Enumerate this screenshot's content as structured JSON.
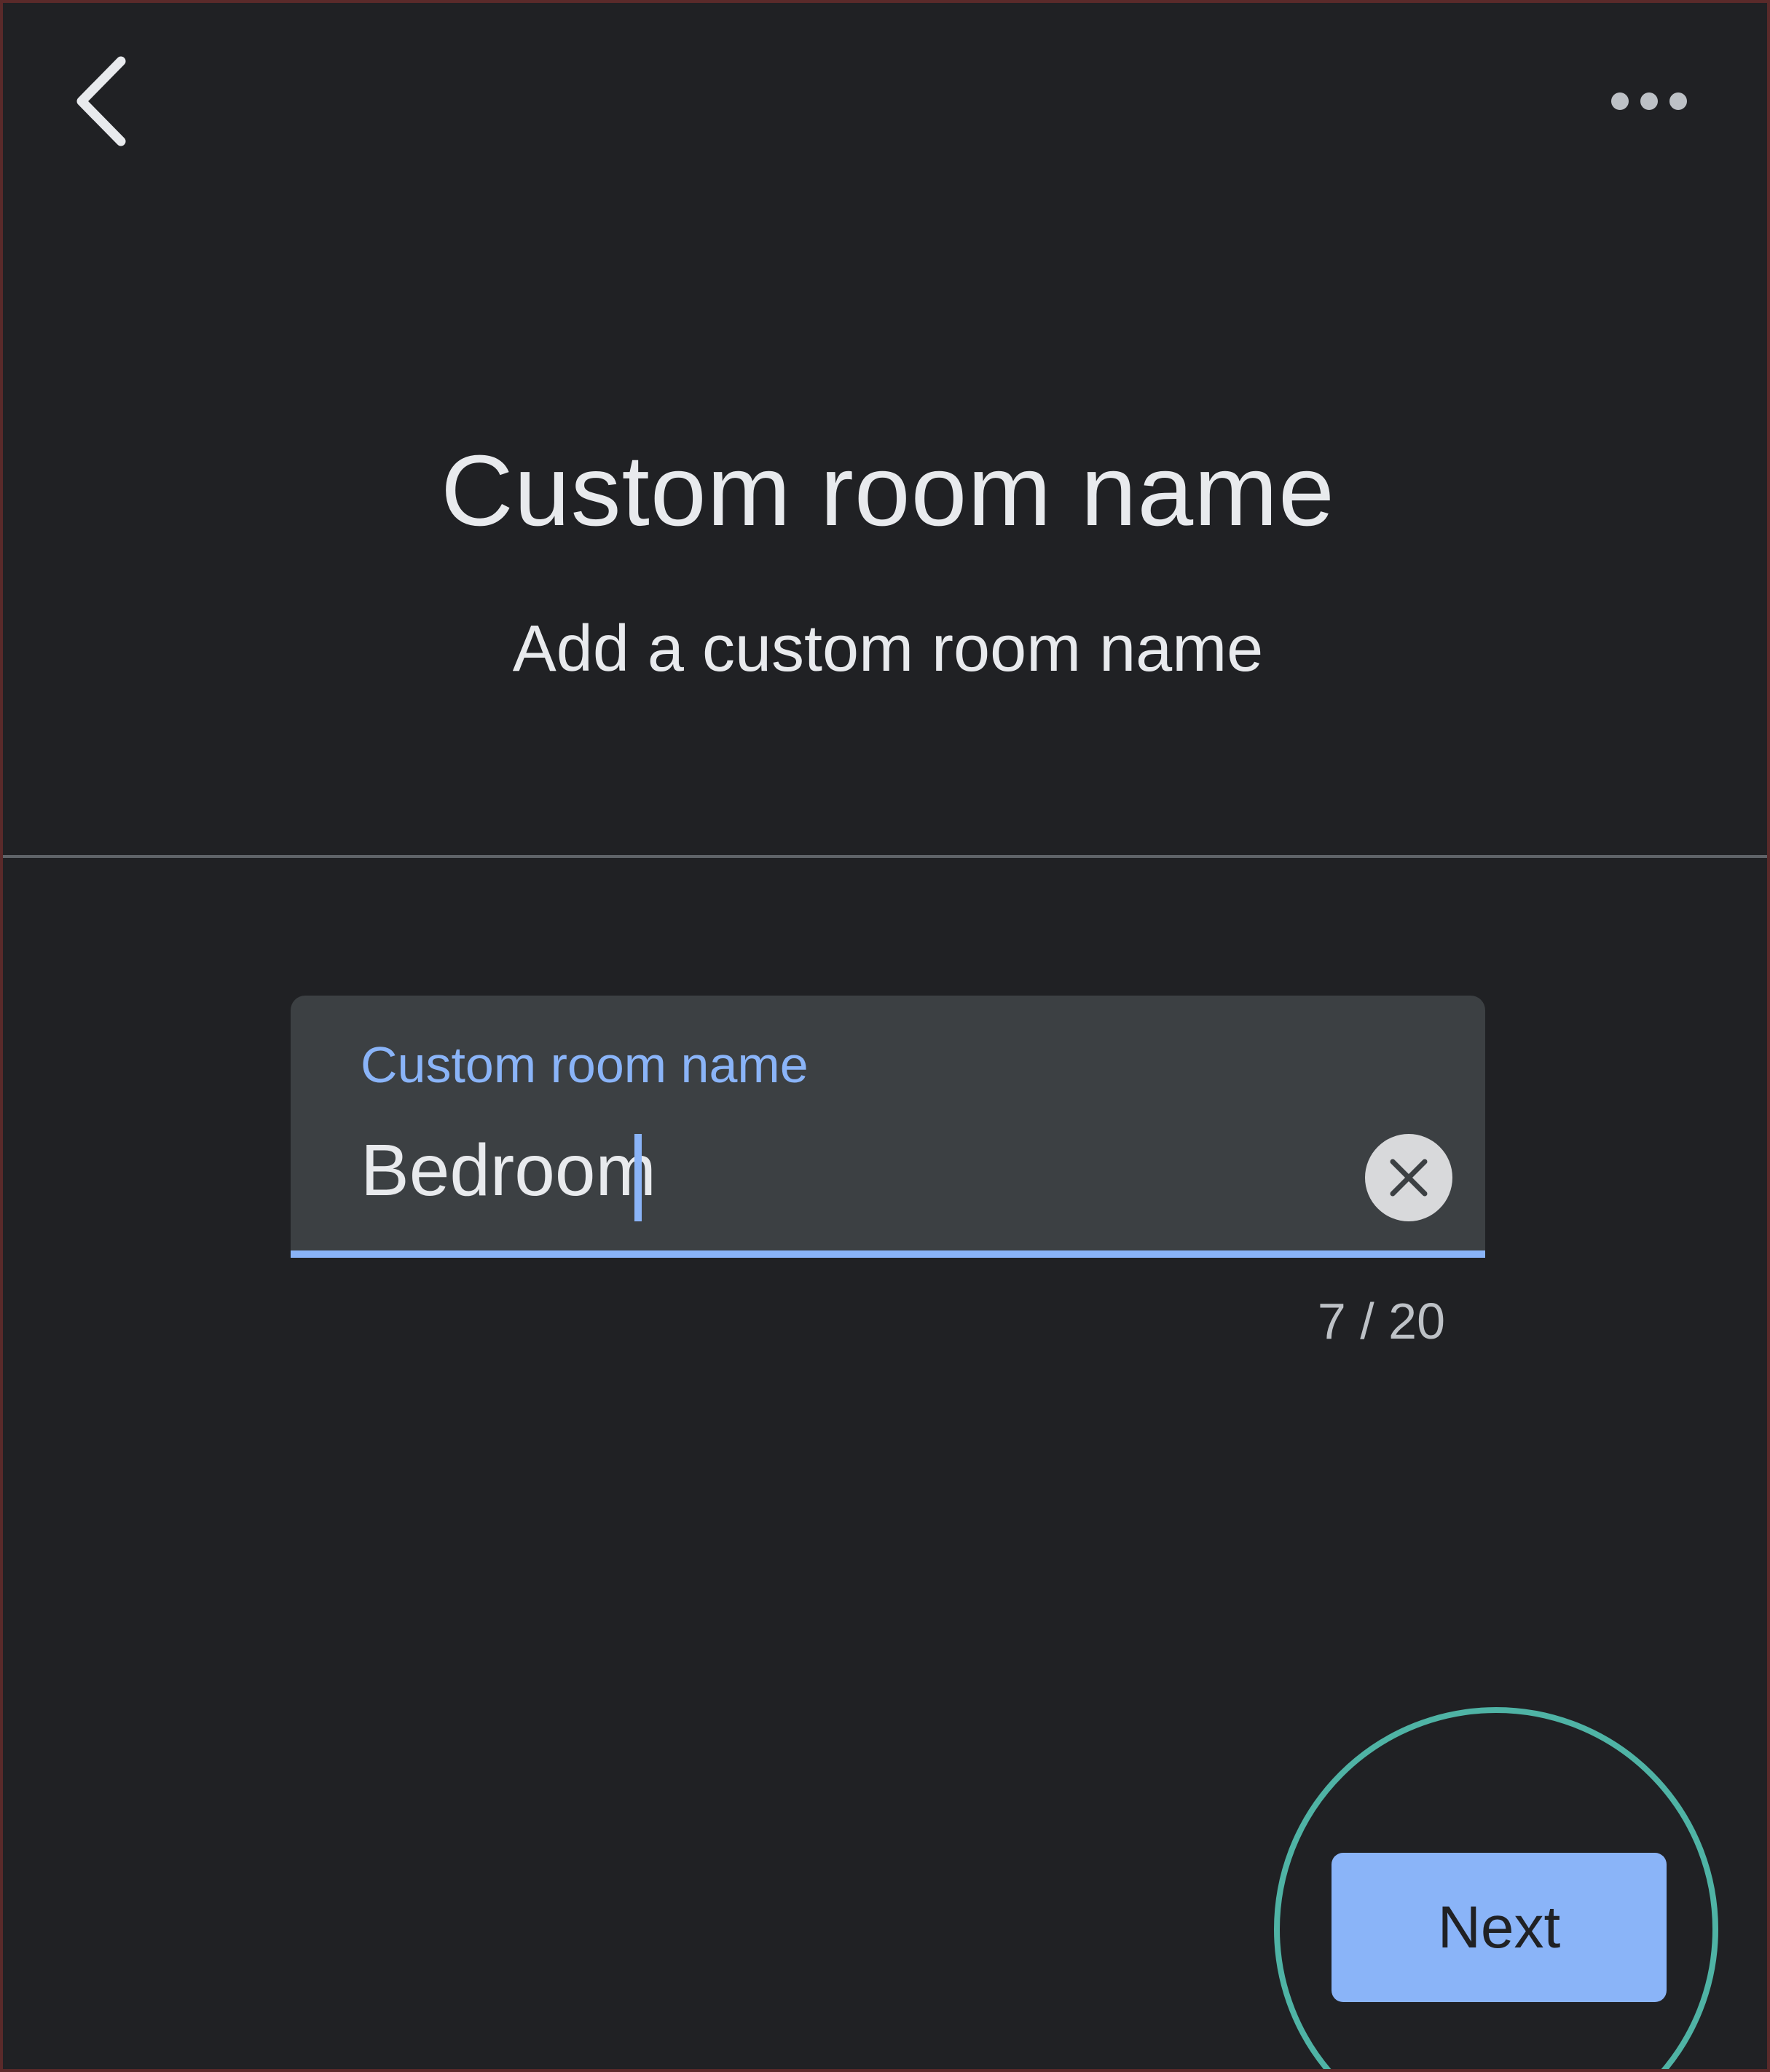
{
  "header": {
    "back_icon": "chevron-left-icon",
    "more_icon": "more-horizontal-icon"
  },
  "page": {
    "title": "Custom room name",
    "subtitle": "Add a custom room name"
  },
  "field": {
    "label": "Custom room name",
    "value": "Bedroom",
    "counter": "7 / 20",
    "clear_icon": "close-icon"
  },
  "actions": {
    "next_label": "Next"
  },
  "colors": {
    "background": "#202124",
    "field_background": "#3c4043",
    "accent": "#8ab4f8",
    "highlight_ring": "#4fb3a5"
  }
}
